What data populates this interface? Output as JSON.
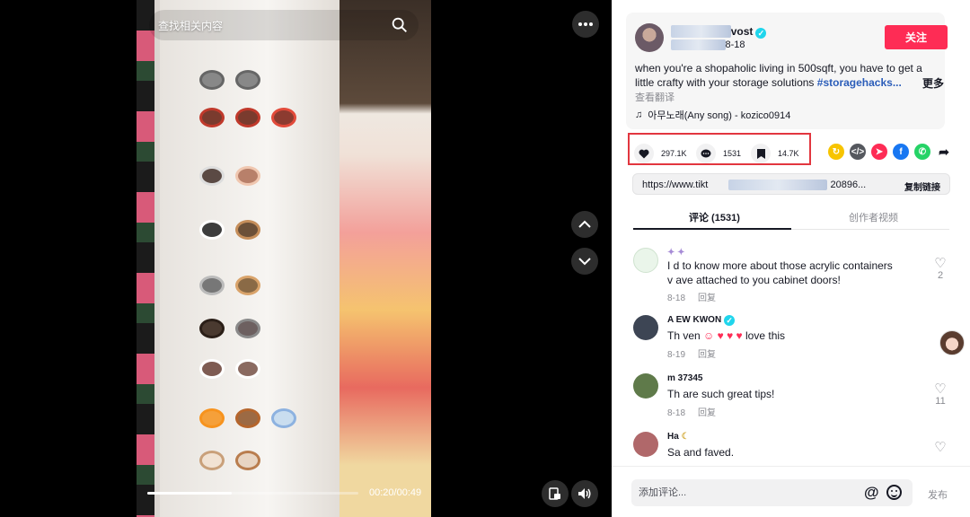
{
  "video": {
    "search_placeholder": "查找相关内容",
    "time": "00:20/00:49",
    "progress_fraction": 0.4
  },
  "post": {
    "author_suffix": "vost",
    "date_suffix": "8-18",
    "follow_label": "关注",
    "description": "when you're a shopaholic living in 500sqft, you have to get a little crafty with your storage solutions",
    "hashtag": "#storagehacks...",
    "more_label": "更多",
    "translate_label": "查看翻译",
    "music": "아무노래(Any song) - kozico0914"
  },
  "actions": {
    "likes": "297.1K",
    "comments": "1531",
    "saves": "14.7K"
  },
  "share": {
    "link_prefix": "https://www.tikt",
    "link_suffix": "20896...",
    "copy_label": "复制链接"
  },
  "tabs": {
    "comments": "评论 (1531)",
    "creator_videos": "创作者视频"
  },
  "comments": [
    {
      "user": "",
      "text_line1": "I     d to know more about those acrylic containers",
      "text_line2": "v     ave attached to you cabinet doors!",
      "date": "8-18",
      "reply": "回复",
      "likes": "2"
    },
    {
      "user": "A      EW KWON",
      "text": "Th     ven",
      "text_end": "love this",
      "date": "8-19",
      "reply": "回复",
      "likes": ""
    },
    {
      "user": "m      37345",
      "text": "Th    are such great tips!",
      "date": "8-18",
      "reply": "回复",
      "likes": "11"
    },
    {
      "user": "Ha",
      "text": "Sa     and faved.",
      "date": "",
      "reply": "",
      "likes": ""
    }
  ],
  "input": {
    "placeholder": "添加评论...",
    "post_label": "发布"
  }
}
